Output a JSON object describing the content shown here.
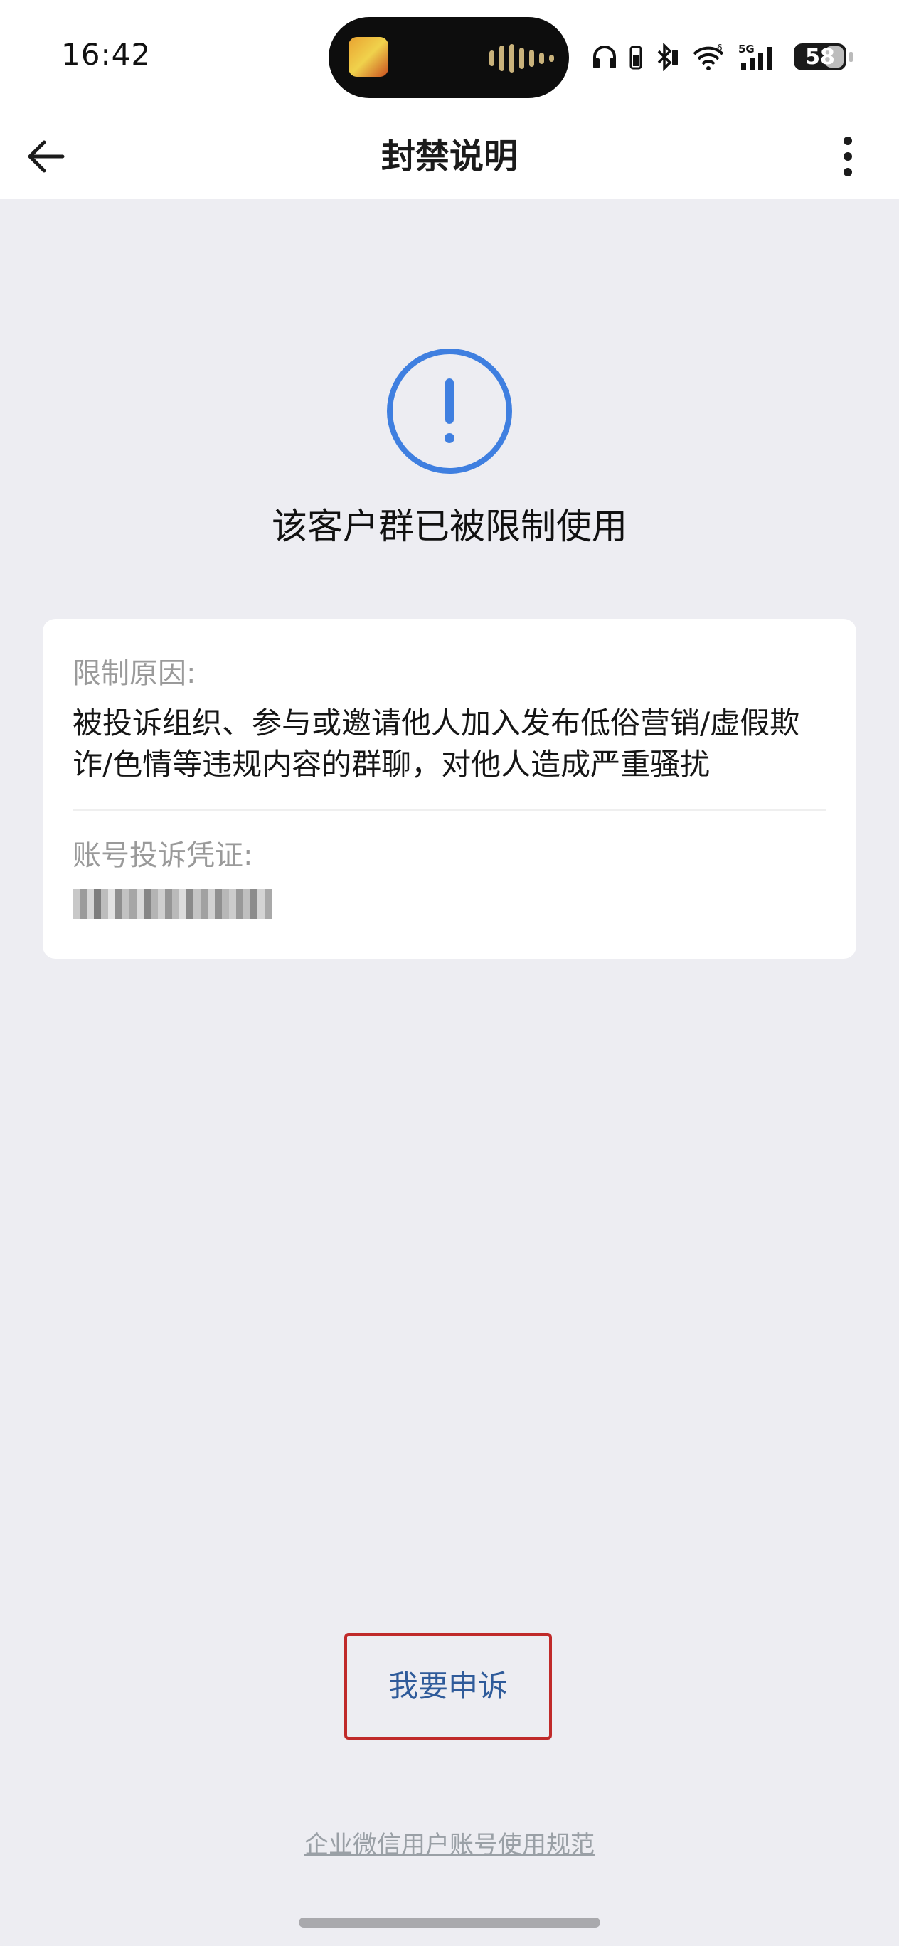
{
  "status_bar": {
    "time": "16:42",
    "network": "5G",
    "battery": "58",
    "icons": [
      "headphones-icon",
      "bluetooth-icon",
      "wifi-icon",
      "signal-icon",
      "battery-icon"
    ]
  },
  "navbar": {
    "title": "封禁说明",
    "back_icon": "arrow-left-icon",
    "more_icon": "vertical-ellipsis-icon"
  },
  "notice": {
    "icon": "exclamation-circle-icon",
    "headline": "该客户群已被限制使用",
    "accent_color": "#3f7fe0"
  },
  "detail_card": {
    "reason_label": "限制原因:",
    "reason_text": "被投诉组织、参与或邀请他人加入发布低俗营销/虚假欺诈/色情等违规内容的群聊，对他人造成严重骚扰",
    "evidence_label": "账号投诉凭证:"
  },
  "actions": {
    "appeal_label": "我要申诉",
    "footer_link": "企业微信用户账号使用规范"
  }
}
